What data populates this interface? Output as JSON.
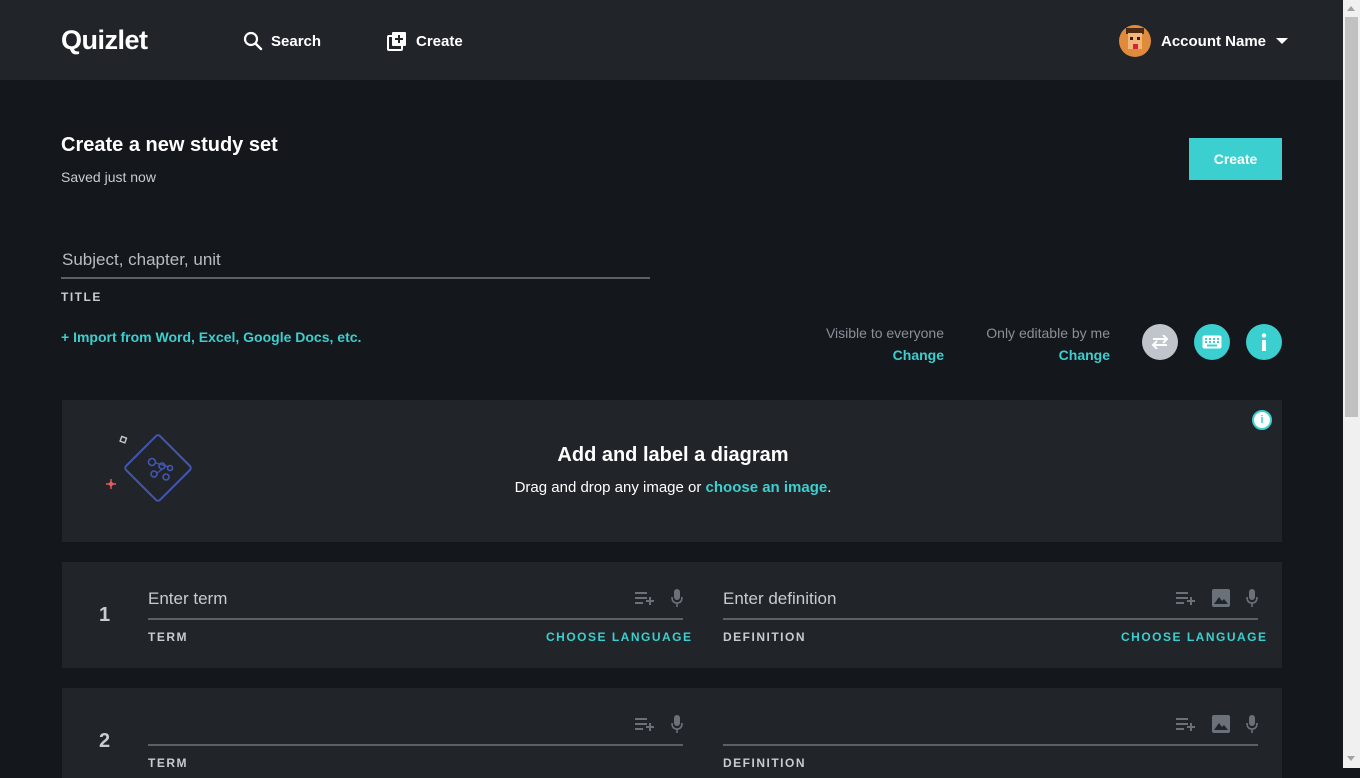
{
  "header": {
    "logo": "Quizlet",
    "search_label": "Search",
    "create_label": "Create",
    "account_name": "Account Name"
  },
  "page": {
    "title": "Create a new study set",
    "saved_status": "Saved just now",
    "create_button": "Create",
    "title_placeholder": "Subject, chapter, unit",
    "title_label": "TITLE",
    "import_link": "+ Import from Word, Excel, Google Docs, etc."
  },
  "permissions": {
    "visibility_label": "Visible to everyone",
    "visibility_change": "Change",
    "edit_label": "Only editable by me",
    "edit_change": "Change"
  },
  "diagram": {
    "title": "Add and label a diagram",
    "text_before": "Drag and drop any image or ",
    "link": "choose an image",
    "text_after": "."
  },
  "cards": [
    {
      "number": "1",
      "term_placeholder": "Enter term",
      "term_label": "TERM",
      "term_lang": "CHOOSE LANGUAGE",
      "def_placeholder": "Enter definition",
      "def_label": "DEFINITION",
      "def_lang": "CHOOSE LANGUAGE"
    },
    {
      "number": "2",
      "term_placeholder": "",
      "term_label": "TERM",
      "def_placeholder": "",
      "def_label": "DEFINITION"
    }
  ],
  "colors": {
    "accent": "#3ccfcf",
    "background": "#14171b",
    "surface": "#212428"
  }
}
